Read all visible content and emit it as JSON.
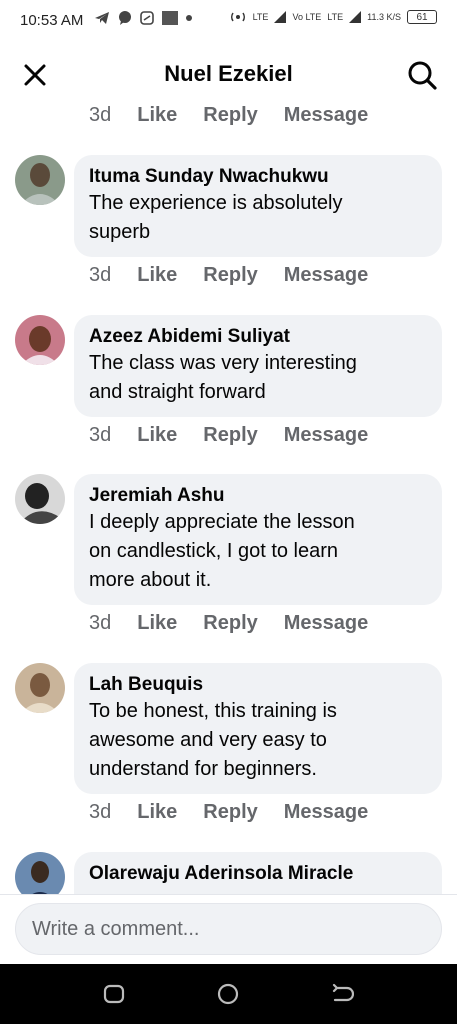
{
  "status_bar": {
    "time": "10:53 AM",
    "network1": "LTE",
    "network2": "Vo LTE",
    "network3": "LTE",
    "speed": "11.3 K/S",
    "battery": "61"
  },
  "header": {
    "title": "Nuel Ezekiel"
  },
  "top_actions": {
    "time": "3d",
    "like": "Like",
    "reply": "Reply",
    "message": "Message"
  },
  "comments": [
    {
      "author": "Ituma Sunday Nwachukwu",
      "lines": [
        "The experience is absolutely",
        "superb"
      ],
      "time": "3d",
      "like": "Like",
      "reply": "Reply",
      "message": "Message"
    },
    {
      "author": "Azeez Abidemi Suliyat",
      "lines": [
        "The class was very interesting",
        "and straight forward"
      ],
      "time": "3d",
      "like": "Like",
      "reply": "Reply",
      "message": "Message"
    },
    {
      "author": "Jeremiah Ashu",
      "lines": [
        "I deeply appreciate the lesson",
        "on candlestick, I got to learn",
        "more about it."
      ],
      "time": "3d",
      "like": "Like",
      "reply": "Reply",
      "message": "Message"
    },
    {
      "author": "Lah Beuquis",
      "lines": [
        "To be honest, this training is",
        "awesome and very easy to",
        "understand for beginners."
      ],
      "time": "3d",
      "like": "Like",
      "reply": "Reply",
      "message": "Message"
    },
    {
      "author": "Olarewaju Aderinsola Miracle",
      "lines": [],
      "time": "",
      "like": "",
      "reply": "",
      "message": ""
    }
  ],
  "composer": {
    "placeholder": "Write a comment..."
  },
  "colors": {
    "bubble": "#f0f2f5",
    "secondary_text": "#65676b",
    "primary_text": "#050505",
    "link_blue": "#1877f2"
  },
  "icons": [
    "close-icon",
    "search-icon",
    "back-nav-icon",
    "home-nav-icon",
    "recents-nav-icon"
  ]
}
